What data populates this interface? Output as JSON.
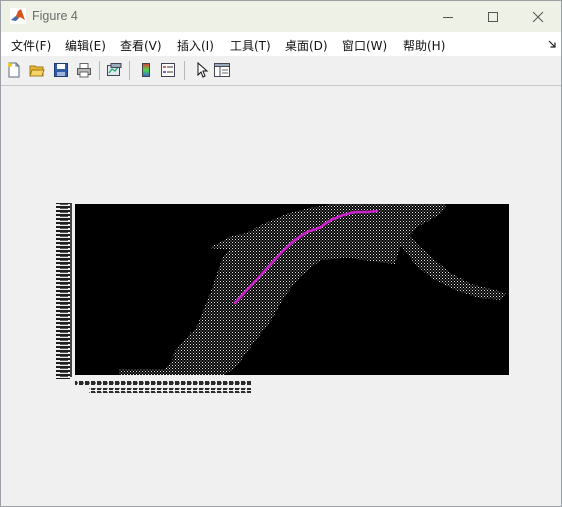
{
  "window": {
    "title": "Figure 4",
    "app_icon": "matlab-icon",
    "controls": [
      "minimize-icon",
      "maximize-icon",
      "close-icon"
    ]
  },
  "menu": {
    "items": [
      {
        "label": "文件(F)"
      },
      {
        "label": "编辑(E)"
      },
      {
        "label": "查看(V)"
      },
      {
        "label": "插入(I)"
      },
      {
        "label": "工具(T)"
      },
      {
        "label": "桌面(D)"
      },
      {
        "label": "窗口(W)"
      },
      {
        "label": "帮助(H)"
      }
    ],
    "overflow_icon": "dock-arrow-icon"
  },
  "toolbar": {
    "icons": [
      "new-figure-icon",
      "open-icon",
      "save-icon",
      "print-icon",
      "link-plot-icon",
      "colorbar-icon",
      "legend-icon",
      "select-arrow-icon",
      "property-editor-icon"
    ]
  },
  "colors": {
    "plot_background": "#000000",
    "texture_dots": "#ffffff",
    "path_line": "#cc22cc",
    "axis_label_ink": "#222222"
  }
}
